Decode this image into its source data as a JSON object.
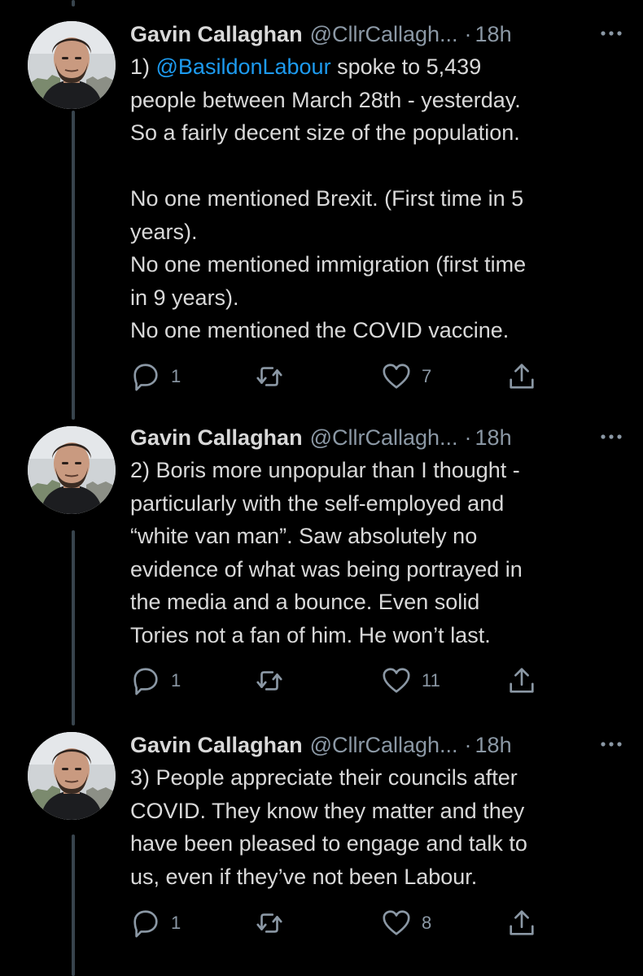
{
  "tweets": [
    {
      "author_name": "Gavin Callaghan",
      "handle": "@CllrCallagh...",
      "time": "18h",
      "text_prefix": "1) ",
      "mention": "@BasildonLabour",
      "text": " spoke to 5,439\npeople between March 28th - yesterday.\nSo a fairly decent size of the population.\n\nNo one mentioned Brexit. (First time in 5\nyears).\nNo one mentioned immigration (first time\nin 9 years).\nNo one mentioned the COVID vaccine.",
      "replies": "1",
      "retweets": "",
      "likes": "7"
    },
    {
      "author_name": "Gavin Callaghan",
      "handle": "@CllrCallagh...",
      "time": "18h",
      "text": "2) Boris more unpopular than I thought -\nparticularly with the self-employed and\n“white van man”. Saw absolutely no\nevidence of what was being portrayed in\nthe media and a bounce. Even solid\nTories not a fan of him. He won’t last.",
      "replies": "1",
      "retweets": "",
      "likes": "11"
    },
    {
      "author_name": "Gavin Callaghan",
      "handle": "@CllrCallagh...",
      "time": "18h",
      "text": "3) People appreciate their councils after\nCOVID. They know they matter and they\nhave been pleased to engage and talk to\nus, even if they’ve not been Labour.",
      "replies": "1",
      "retweets": "",
      "likes": "8"
    }
  ],
  "icons": {
    "reply": "reply-icon",
    "retweet": "retweet-icon",
    "like": "heart-icon",
    "share": "share-icon",
    "more": "more-icon"
  },
  "colors": {
    "background": "#000000",
    "text": "#d9d9d9",
    "secondary": "#8b98a5",
    "link": "#1d9bf0",
    "thread_line": "#38444d"
  }
}
